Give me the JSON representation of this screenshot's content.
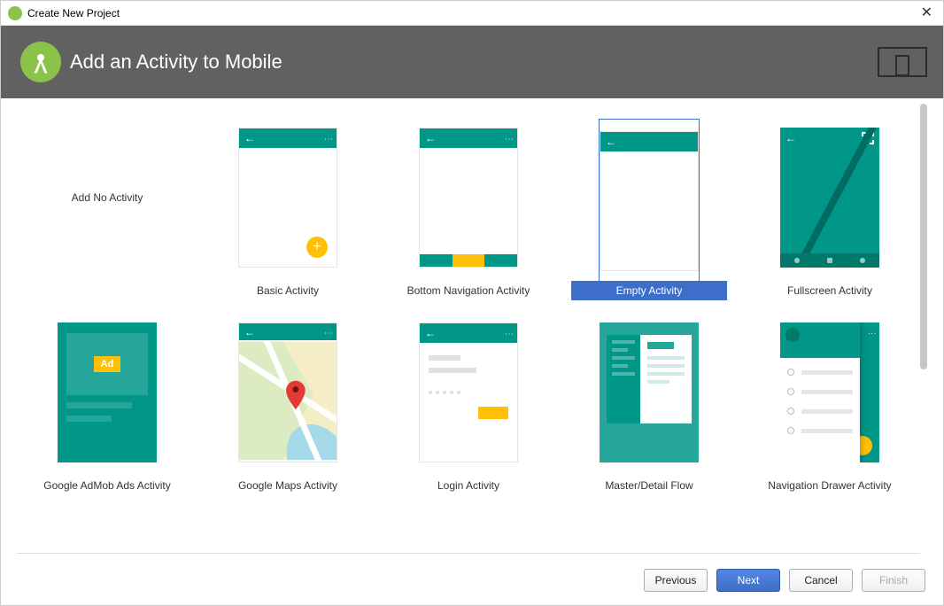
{
  "window": {
    "title": "Create New Project"
  },
  "banner": {
    "title": "Add an Activity to Mobile"
  },
  "templates": [
    {
      "key": "none",
      "label": "Add No Activity",
      "selected": false
    },
    {
      "key": "basic",
      "label": "Basic Activity",
      "selected": false
    },
    {
      "key": "bottomnav",
      "label": "Bottom Navigation Activity",
      "selected": false
    },
    {
      "key": "empty",
      "label": "Empty Activity",
      "selected": true
    },
    {
      "key": "fullscreen",
      "label": "Fullscreen Activity",
      "selected": false
    },
    {
      "key": "admob",
      "label": "Google AdMob Ads Activity",
      "selected": false
    },
    {
      "key": "maps",
      "label": "Google Maps Activity",
      "selected": false
    },
    {
      "key": "login",
      "label": "Login Activity",
      "selected": false
    },
    {
      "key": "master",
      "label": "Master/Detail Flow",
      "selected": false
    },
    {
      "key": "drawer",
      "label": "Navigation Drawer Activity",
      "selected": false
    }
  ],
  "ad_label": "Ad",
  "footer": {
    "previous": "Previous",
    "next": "Next",
    "cancel": "Cancel",
    "finish": "Finish"
  }
}
